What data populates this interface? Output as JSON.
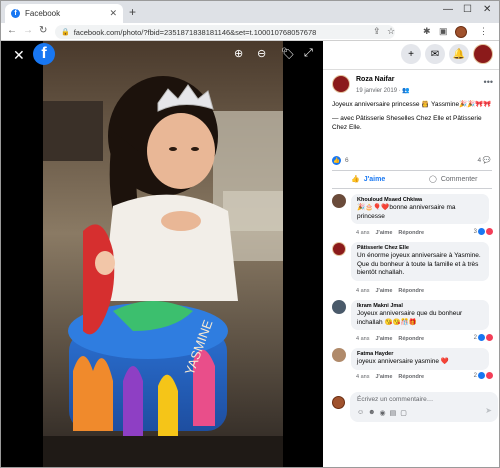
{
  "browser": {
    "tab_title": "Facebook",
    "url": "facebook.com/photo/?fbid=2351871838181146&set=t.100010768057678"
  },
  "post": {
    "author": "Roza Naifar",
    "date": "19 janvier 2019 ·",
    "text_line1": "Joyeux anniversaire princesse 👸 Yassmine🎉🎉🎀🎀",
    "text_line2": "— avec Pâtisserie Sheselles Chez Elle et Pâtisserie Chez Elle.",
    "reaction_count": "6",
    "comment_count": "4",
    "like_label": "J'aime",
    "comment_label": "Commenter"
  },
  "comments": [
    {
      "name": "Khouloud Msaed Chkiwa",
      "text": "🎉🎂🎈❤️bonne anniversaire ma princesse",
      "time": "4 ans",
      "like": "J'aime",
      "reply": "Répondre",
      "reactions": "3"
    },
    {
      "name": "Pâtisserie Chez Elle",
      "text": "Un énorme joyeux anniversaire à Yasmine. Que du bonheur à toute la famille et à très bientôt nchallah.",
      "time": "4 ans",
      "like": "J'aime",
      "reply": "Répondre",
      "reactions": ""
    },
    {
      "name": "Ikram Makni Jmal",
      "text": "Joyeux anniversaire que du bonheur inchallah 😘😘🎊🎁",
      "time": "4 ans",
      "like": "J'aime",
      "reply": "Répondre",
      "reactions": "2"
    },
    {
      "name": "Fatma Hayder",
      "text": "joyeux anniversaire yasmine ❤️",
      "time": "4 ans",
      "like": "J'aime",
      "reply": "Répondre",
      "reactions": "2"
    }
  ],
  "composer": {
    "placeholder": "Écrivez un commentaire…"
  },
  "colors": {
    "facebook_blue": "#1877f2",
    "love_red": "#f33e58"
  }
}
